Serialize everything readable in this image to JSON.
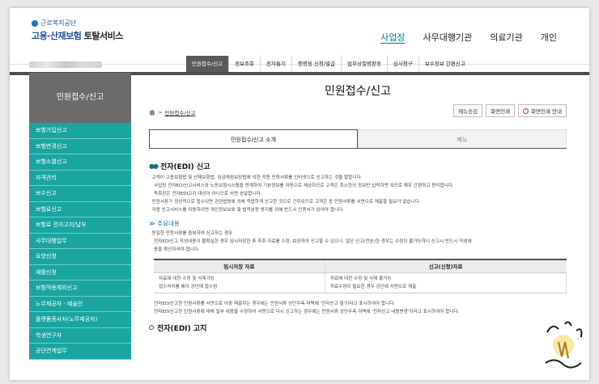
{
  "logo": {
    "org": "근로복지공단",
    "service_pre": "고용·산재보험",
    "service_post": "토탈서비스"
  },
  "topnav": [
    "사업장",
    "사무대행기관",
    "의료기관",
    "개인"
  ],
  "gnb": [
    "민원접수/신고",
    "정보조회",
    "전자통지",
    "증명원 신청/발급",
    "업무상질병판정",
    "심사청구",
    "보수정보 간편신고"
  ],
  "sidebar": {
    "title": "민원접수/신고",
    "items": [
      "보험가입신고",
      "보험변경신고",
      "보험소멸신고",
      "자격관리",
      "보수신고",
      "보험료신고",
      "보험료 전자고지/납부",
      "사무대행업무",
      "요양신청",
      "재활신청",
      "보험적용제외신고",
      "노무제공자 · 예술인",
      "플랫폼종사자(노무제공자)",
      "학생연구자",
      "공단연계업무"
    ]
  },
  "main": {
    "title": "민원접수/신고",
    "breadcrumb": "민원접수/신고",
    "buttons": [
      "메뉴승김",
      "화면인쇄",
      "화면인쇄 안내"
    ],
    "tabs": [
      "민원접수/신고 소개",
      "메뉴"
    ],
    "sec1_title": "전자(EDI) 신고",
    "sec1_lines": [
      "· 고객이 고용보험법 및 산재보험법, 임금채권보장법에 의한 각종 민원서류를 인터넷으로 신고하는 것을 말합니다.",
      "사업장 전자EDI신고서비스와 노동보험시스템을 연계하여 기본정보를 자동으로 제공하므로 고객은 최소한의 정보만 입력하면 되므로 매우 간편하고 편리합니다.",
      "독촉장은 전자EDI고지 대상이 아니므로 서면 송달합니다.",
      "· 민원서류가 정상적으로 접수되면 관련법령에 의해 적법하게 신고한 것으로 간주되므로 고객은 동 민원서류를 서면으로 제출할 필요가 없습니다.",
      "· 각종 신고서비스를 이용하려면 개인정보보호 및 법적분쟁 방지를 위해 반드시 인증서가 있어야 합니다."
    ],
    "note_title": "≫ 주요내용",
    "note_lines": [
      "· 동일한 민원서류를 중복하여 신고하는 경우",
      "전자EDI신고 작성내용이 불확실한 경우 임시저장한 후 추후 자료를 수정, 보완하여 신고할 수 있으나, 일단 신고(전송)한 경우는 수정이 불가능하니 신고시 반드시 작성내",
      "용을 확인하셔야 합니다."
    ],
    "table": {
      "headers": [
        "임시저장 자료",
        "신고(신청)자료"
      ],
      "rows": [
        [
          "자료에 대한 수정 및 삭제가능",
          "자료에 대한 수정 및 삭제 불가능"
        ],
        [
          "접수처리를 해야 공단에 접수됨",
          "자료수정이 필요한 경우 공단에 서면으로 제출"
        ]
      ]
    },
    "after_lines": [
      "전자EDI신고한 민원서류를 서면으로 이중 제출하는 경우에는 민원서류 상단우측 여백에 '전자신고 필'이라고 표시하여야 합니다.",
      "전자EDI신고한 민원서류에 대해 일부 내용을 수정하여 서면으로 다시 신고하는 경우에는 민원서류 상단우측 여백에 '전자신고 내용변경'이라고 표시하여야 합니다."
    ],
    "sec2_title": "전자(EDI) 고지"
  },
  "colors": {
    "accent": "#1aa5a0",
    "nav_dark": "#5a5a5a"
  }
}
